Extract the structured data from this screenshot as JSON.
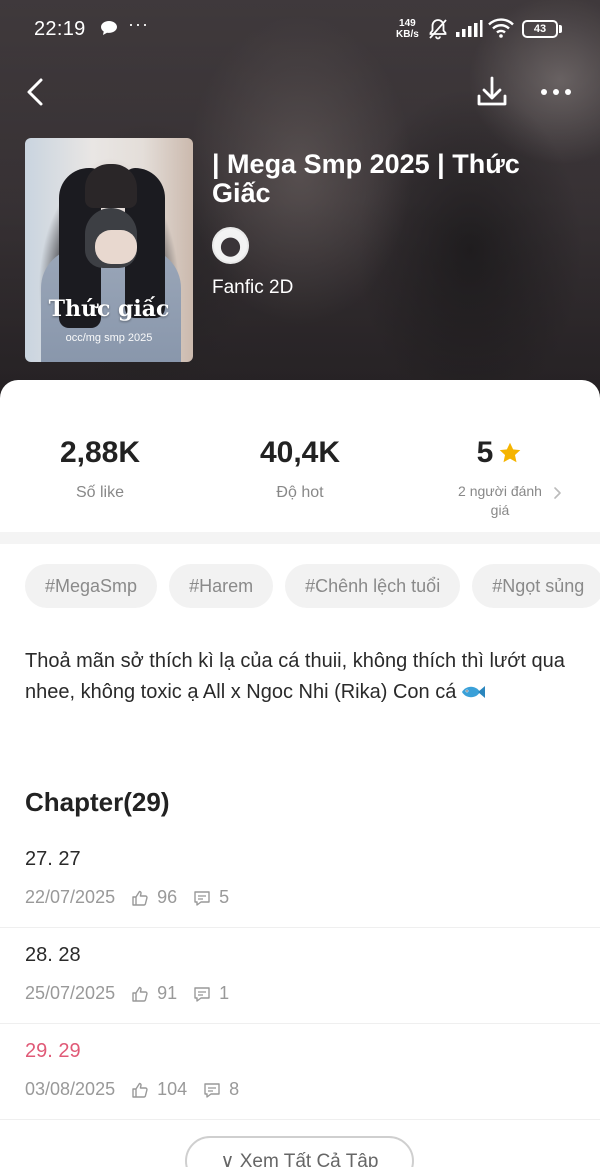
{
  "status_bar": {
    "time": "22:19",
    "more": "···",
    "speed_value": "149",
    "speed_unit": "KB/s",
    "battery": "43"
  },
  "icons": {
    "back": "chevron-left-icon",
    "download": "download-icon",
    "more": "more-horizontal-icon",
    "star": "star-icon",
    "like": "thumbs-up-icon",
    "comment": "comment-icon",
    "fish": "fish-emoji-icon"
  },
  "colors": {
    "accent": "#e05a77",
    "star": "#f5b400",
    "muted_text": "#999999",
    "tag_bg": "#f2f2f2"
  },
  "book": {
    "cover_title": "Thức giấc",
    "cover_subtitle": "occ/mg smp 2025",
    "title": "| Mega Smp 2025 | Thức Giấc",
    "category": "Fanfic 2D"
  },
  "stats": {
    "likes": {
      "value": "2,88K",
      "label": "Số like"
    },
    "hot": {
      "value": "40,4K",
      "label": "Độ hot"
    },
    "rating": {
      "value": "5",
      "label_line1": "2 người đánh",
      "label_line2": "giá"
    }
  },
  "tags": [
    "#MegaSmp",
    "#Harem",
    "#Chênh lệch tuổi",
    "#Ngọt sủng"
  ],
  "description": "Thoả mãn sở thích kì lạ của cá thuii, không thích thì lướt qua nhee, không toxic ạ All x Ngoc Nhi (Rika) Con cá",
  "chapters": {
    "heading": "Chapter(29)",
    "items": [
      {
        "title": "27. 27",
        "date": "22/07/2025",
        "likes": "96",
        "comments": "5",
        "current": false
      },
      {
        "title": "28. 28",
        "date": "25/07/2025",
        "likes": "91",
        "comments": "1",
        "current": false
      },
      {
        "title": "29. 29",
        "date": "03/08/2025",
        "likes": "104",
        "comments": "8",
        "current": true
      }
    ],
    "view_all": "∨ Xem Tất Cả Tập"
  }
}
